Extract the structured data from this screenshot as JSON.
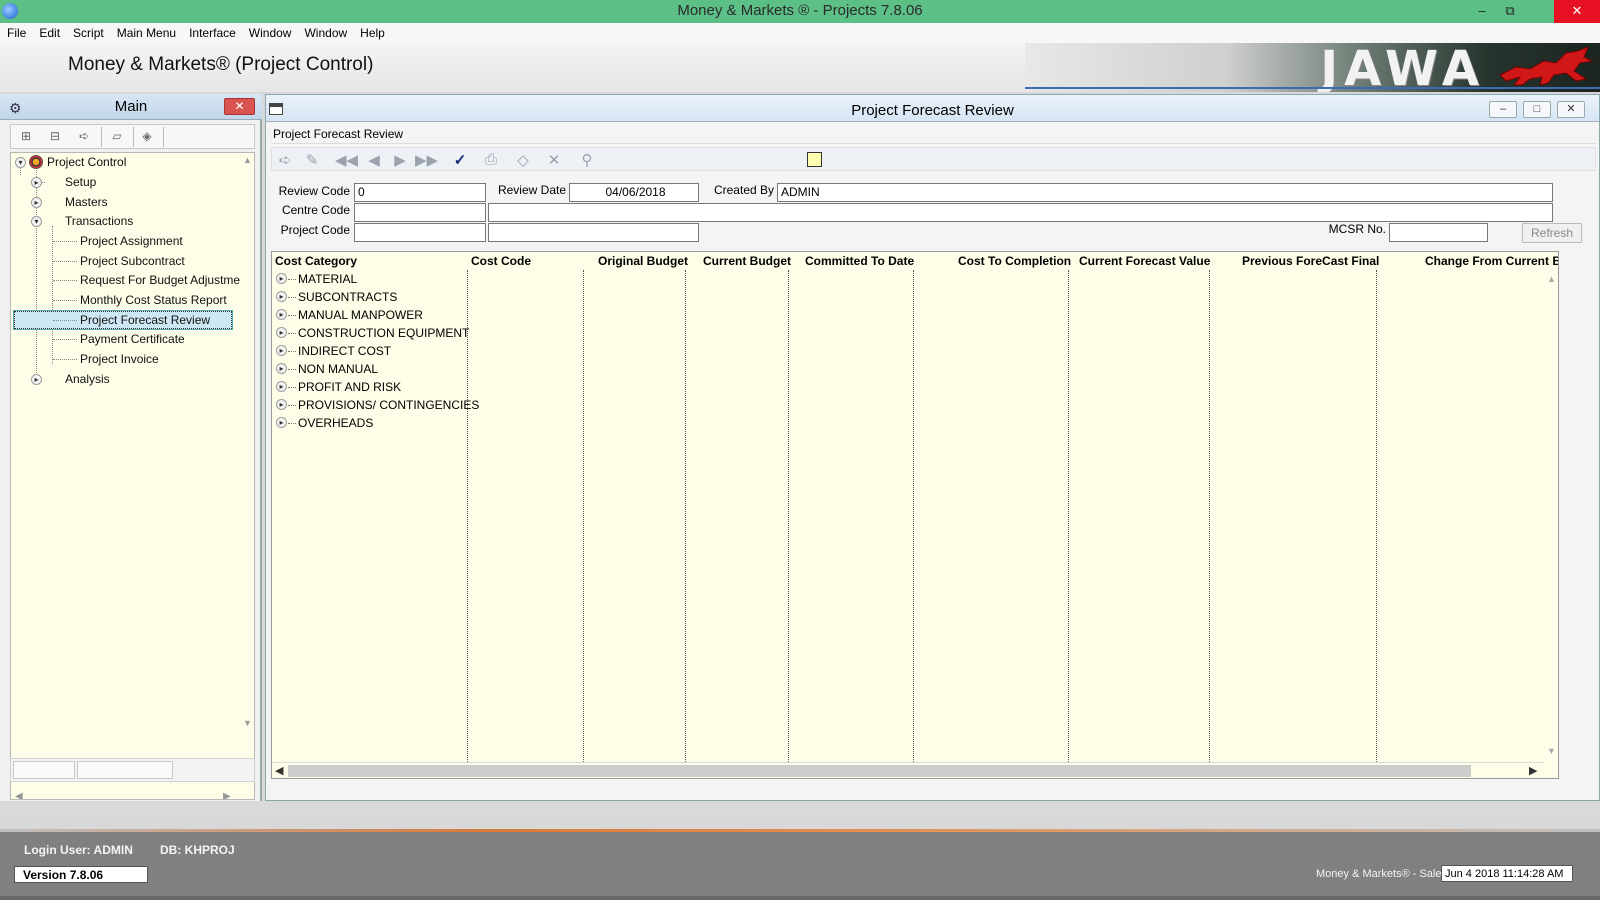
{
  "window": {
    "title": "Money & Markets ® - Projects     7.8.06",
    "minimize": "–",
    "restore": "⧉",
    "close": "✕"
  },
  "menu": [
    "File",
    "Edit",
    "Script",
    "Main Menu",
    "Interface",
    "Window",
    "Window",
    "Help"
  ],
  "banner": {
    "title": "Money & Markets® (Project Control)",
    "logo_text": "JAWA"
  },
  "main_panel": {
    "title": "Main",
    "close": "✕",
    "tree": {
      "root": "Project Control",
      "items": [
        {
          "label": "Setup",
          "level": 1,
          "expander": "▸"
        },
        {
          "label": "Masters",
          "level": 1,
          "expander": "▸"
        },
        {
          "label": "Transactions",
          "level": 1,
          "expander": "▾"
        },
        {
          "label": "Project Assignment",
          "level": 2
        },
        {
          "label": "Project Subcontract",
          "level": 2
        },
        {
          "label": "Request For Budget Adjustment",
          "level": 2
        },
        {
          "label": "Monthly Cost Status Report",
          "level": 2
        },
        {
          "label": "Project Forecast Review",
          "level": 2,
          "selected": true
        },
        {
          "label": "Payment Certificate",
          "level": 2
        },
        {
          "label": "Project Invoice",
          "level": 2
        },
        {
          "label": "Analysis",
          "level": 1,
          "expander": "▸"
        }
      ]
    }
  },
  "forecast_window": {
    "title": "Project Forecast Review",
    "subtitle": "Project Forecast Review",
    "btn_min": "–",
    "btn_max": "□",
    "btn_close": "✕",
    "form": {
      "review_code_label": "Review Code",
      "review_code_value": "0",
      "review_date_label": "Review Date",
      "review_date_value": "04/06/2018",
      "created_by_label": "Created By",
      "created_by_value": "ADMIN",
      "centre_code_label": "Centre Code",
      "project_code_label": "Project Code",
      "mcsr_label": "MCSR No.",
      "refresh_label": "Refresh"
    },
    "grid": {
      "columns": [
        "Cost Category",
        "Cost Code",
        "Original Budget",
        "Current Budget",
        "Committed To Date",
        "Cost To Completion",
        "Current Forecast Value",
        "Previous ForeCast Final",
        "Change From Current Bu"
      ],
      "rows": [
        "MATERIAL",
        "SUBCONTRACTS",
        "MANUAL MANPOWER",
        "CONSTRUCTION EQUIPMENT",
        "INDIRECT COST",
        "NON MANUAL",
        "PROFIT AND RISK",
        "PROVISIONS/ CONTINGENCIES",
        "OVERHEADS"
      ]
    }
  },
  "statusbar": {
    "login": "Login User: ADMIN",
    "db": "DB: KHPROJ",
    "version": "Version 7.8.06",
    "product": "Money & Markets® - Sale",
    "datetime": "Jun 4 2018  11:14:28 AM"
  }
}
